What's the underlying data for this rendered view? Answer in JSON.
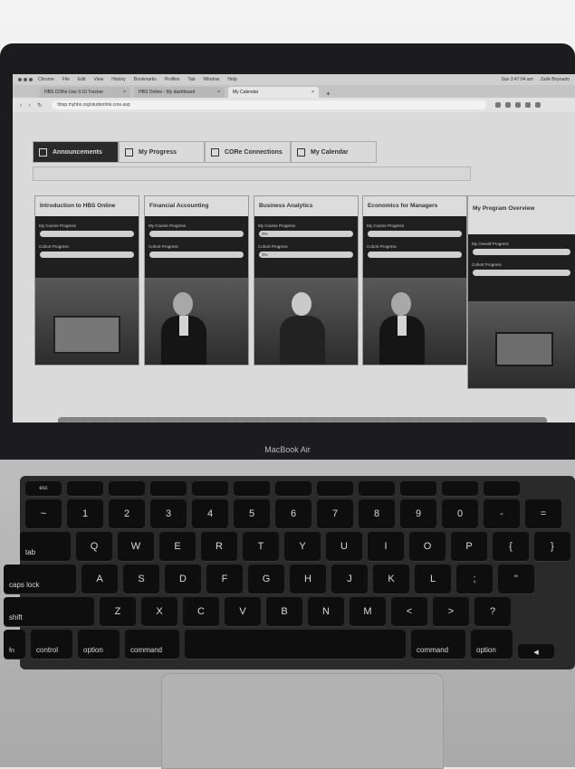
{
  "menubar": {
    "items": [
      "Chrome",
      "File",
      "Edit",
      "View",
      "History",
      "Bookmarks",
      "Profiles",
      "Tab",
      "Window",
      "Help"
    ],
    "clock": "Sun 3:47:04 am",
    "user": "Zarik Boyoudo"
  },
  "browser": {
    "tabs": [
      {
        "title": "HBS CORe Use It 10 Tracker"
      },
      {
        "title": "HBS Online - My dashboard"
      },
      {
        "title": "My Calendar"
      }
    ],
    "url": "hbsp.myhbs.org/studentink.core.asp"
  },
  "site": {
    "nav": [
      {
        "label": "Announcements"
      },
      {
        "label": "My Progress"
      },
      {
        "label": "CORe Connections"
      },
      {
        "label": "My Calendar"
      }
    ],
    "cards": [
      {
        "title": "Introduction to HBS Online",
        "course_label": "My Course Progress",
        "cohort_label": "Cohort Progress",
        "course_value": "",
        "cohort_value": ""
      },
      {
        "title": "Financial Accounting",
        "course_label": "My Course Progress",
        "cohort_label": "Cohort Progress",
        "course_value": "",
        "cohort_value": ""
      },
      {
        "title": "Business Analytics",
        "course_label": "My Course Progress",
        "cohort_label": "Cohort Progress",
        "course_value": "0%",
        "cohort_value": "0%"
      },
      {
        "title": "Economics for Managers",
        "course_label": "My Course Progress",
        "cohort_label": "Cohort Progress",
        "course_value": "",
        "cohort_value": ""
      },
      {
        "title": "My Program Overview",
        "course_label": "My Overall Progress",
        "cohort_label": "Cohort Progress",
        "course_value": "",
        "cohort_value": ""
      }
    ]
  },
  "laptop_brand": "MacBook Air",
  "keyboard": {
    "row_num": [
      "~",
      "1",
      "2",
      "3",
      "4",
      "5",
      "6",
      "7",
      "8",
      "9",
      "0",
      "-",
      "="
    ],
    "row_q": [
      "tab",
      "Q",
      "W",
      "E",
      "R",
      "T",
      "Y",
      "U",
      "I",
      "O",
      "P",
      "{",
      "}"
    ],
    "row_a": [
      "caps lock",
      "A",
      "S",
      "D",
      "F",
      "G",
      "H",
      "J",
      "K",
      "L",
      ";",
      "\""
    ],
    "row_z": [
      "shift",
      "Z",
      "X",
      "C",
      "V",
      "B",
      "N",
      "M",
      "<",
      ">",
      "?"
    ],
    "row_mod": [
      "fn",
      "control",
      "option",
      "command",
      "command",
      "option"
    ]
  }
}
